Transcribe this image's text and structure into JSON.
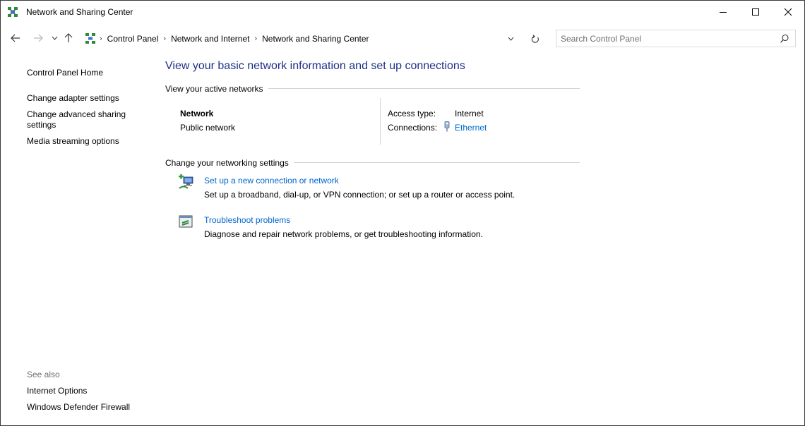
{
  "window": {
    "title": "Network and Sharing Center"
  },
  "navigation": {
    "breadcrumbs": [
      "Control Panel",
      "Network and Internet",
      "Network and Sharing Center"
    ],
    "separator": "›"
  },
  "search": {
    "placeholder": "Search Control Panel",
    "value": ""
  },
  "sidebar": {
    "links": [
      "Control Panel Home",
      "Change adapter settings",
      "Change advanced sharing settings",
      "Media streaming options"
    ],
    "see_also_heading": "See also",
    "see_also": [
      "Internet Options",
      "Windows Defender Firewall"
    ]
  },
  "main": {
    "title": "View your basic network information and set up connections",
    "active_networks_heading": "View your active networks",
    "network": {
      "name": "Network",
      "type": "Public network",
      "access_type_label": "Access type:",
      "access_type_value": "Internet",
      "connections_label": "Connections:",
      "connection_name": "Ethernet"
    },
    "change_settings_heading": "Change your networking settings",
    "tasks": [
      {
        "title": "Set up a new connection or network",
        "description": "Set up a broadband, dial-up, or VPN connection; or set up a router or access point.",
        "icon": "new-connection-icon"
      },
      {
        "title": "Troubleshoot problems",
        "description": "Diagnose and repair network problems, or get troubleshooting information.",
        "icon": "troubleshoot-icon"
      }
    ]
  },
  "colors": {
    "title_blue": "#1e3287",
    "link_blue": "#0066cc",
    "rule_gray": "#d4d4d4",
    "muted_text": "#6d6d6d"
  }
}
